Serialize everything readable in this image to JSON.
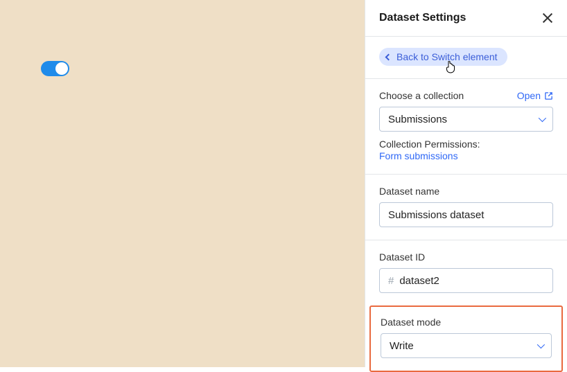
{
  "canvas": {},
  "panel": {
    "title": "Dataset Settings",
    "back_label": "Back to Switch element",
    "collection": {
      "label": "Choose a collection",
      "open_label": "Open",
      "value": "Submissions",
      "permissions_label": "Collection Permissions:",
      "permissions_link": "Form submissions"
    },
    "dataset_name": {
      "label": "Dataset name",
      "value": "Submissions dataset"
    },
    "dataset_id": {
      "label": "Dataset ID",
      "value": "dataset2"
    },
    "dataset_mode": {
      "label": "Dataset mode",
      "value": "Write"
    }
  }
}
